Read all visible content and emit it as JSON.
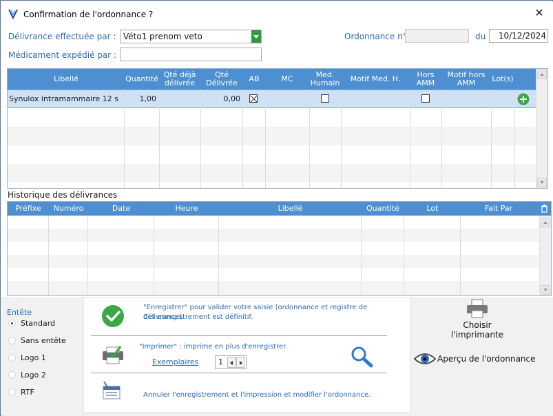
{
  "window": {
    "title": "Confirmation de l'ordonnance ?",
    "close_glyph": "✕"
  },
  "form": {
    "delivrance_label": "Délivrance effectuée par :",
    "delivrance_value": "Véto1 prenom veto",
    "medicament_label": "Médicament expédié par :",
    "medicament_value": "",
    "ordonnance_label": "Ordonnance n°",
    "ordonnance_value": "",
    "du_label": "du",
    "date_value": "10/12/2024"
  },
  "table": {
    "columns": [
      "Libellé",
      "Quantité",
      "Qté déjà délivrée",
      "Qté Délivrée",
      "AB",
      "MC",
      "Med. Humain",
      "Motif Med. H.",
      "Hors AMM",
      "Motif hors AMM",
      "Lot(s)"
    ],
    "rows": [
      {
        "libelle": "Synulox intramammaire 12 s",
        "quantite": "1,00",
        "qte_deja": "",
        "qte_delivree": "0,00",
        "ab": true,
        "mc": "",
        "med_humain": false,
        "motif_med": "",
        "hors_amm": false,
        "motif_hors": "",
        "lots": ""
      }
    ]
  },
  "history": {
    "title": "Historique des délivrances",
    "columns": [
      "Préfixe",
      "Numéro",
      "Date",
      "Heure",
      "Libellé",
      "Quantité",
      "Lot",
      "Fait Par"
    ]
  },
  "entete": {
    "label": "Entête",
    "options": [
      "Standard",
      "Sans entête",
      "Logo 1",
      "Logo 2",
      "RTF"
    ],
    "selected": "Standard"
  },
  "actions": {
    "enregistrer_text_1": "\"Enregistrer\" pour valider votre saisie (ordonnance et registre de délivrance).",
    "enregistrer_text_2": "Cet enregistrement est définitif.",
    "imprimer_text": "\"Imprimer\" : imprime en plus d'enregistrer.",
    "exemplaires_label": "Exemplaires",
    "exemplaires_value": "1",
    "annuler_text": "Annuler l'enregistrement et l'impression et modifier l'ordonnance."
  },
  "side": {
    "choisir_line1": "Choisir",
    "choisir_line2": "l'imprimante",
    "apercu_label": "Aperçu de l'ordonnance"
  },
  "colors": {
    "header_blue": "#4d8fd0",
    "label_blue": "#2a6bb5",
    "selected_row": "#cfe2f5",
    "check_green": "#3aa845"
  }
}
